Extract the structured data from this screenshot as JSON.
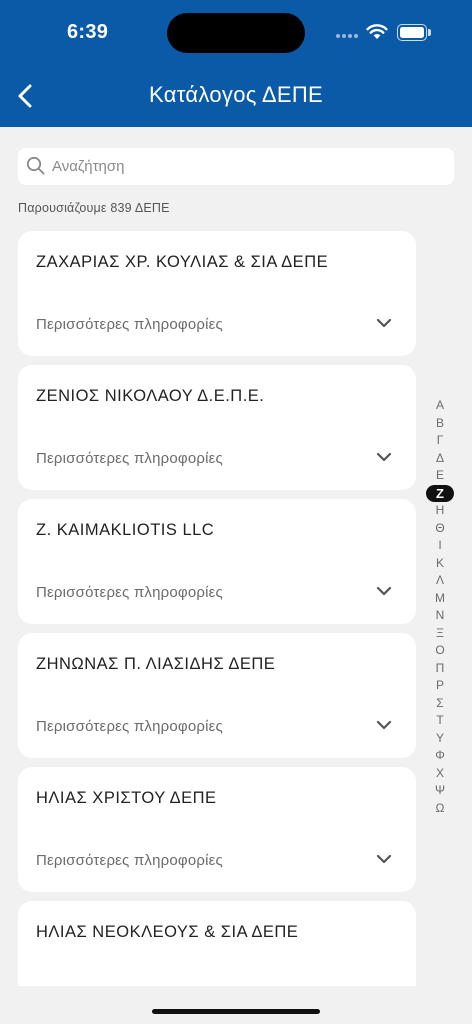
{
  "status_bar": {
    "time": "6:39"
  },
  "header": {
    "title": "Κατάλογος ΔΕΠΕ"
  },
  "search": {
    "placeholder": "Αναζήτηση",
    "value": ""
  },
  "result_count": "Παρουσιάζουμε 839 ΔΕΠΕ",
  "cards": [
    {
      "title": "ΖΑΧΑΡΙΑΣ ΧΡ. ΚΟΥΛΙΑΣ & ΣΙΑ ΔΕΠΕ",
      "more": "Περισσότερες πληροφορίες"
    },
    {
      "title": "ΖΕΝΙΟΣ ΝΙΚΟΛΑΟΥ Δ.Ε.Π.Ε.",
      "more": "Περισσότερες πληροφορίες"
    },
    {
      "title": "Z. KAIMAKLIOTIS LLC",
      "more": "Περισσότερες πληροφορίες"
    },
    {
      "title": "ΖΗΝΩΝΑΣ Π. ΛΙΑΣΙΔΗΣ ΔΕΠΕ",
      "more": "Περισσότερες πληροφορίες"
    },
    {
      "title": "ΗΛΙΑΣ ΧΡΙΣΤΟΥ ΔΕΠΕ",
      "more": "Περισσότερες πληροφορίες"
    },
    {
      "title": "ΗΛΙΑΣ ΝΕΟΚΛΕΟΥΣ & ΣΙΑ ΔΕΠΕ",
      "more": ""
    }
  ],
  "alphabet": [
    "Α",
    "Β",
    "Γ",
    "Δ",
    "Ε",
    "Z",
    "Η",
    "Θ",
    "Ι",
    "Κ",
    "Λ",
    "Μ",
    "Ν",
    "Ξ",
    "Ο",
    "Π",
    "Ρ",
    "Σ",
    "Τ",
    "Υ",
    "Φ",
    "Χ",
    "Ψ",
    "Ω"
  ],
  "alphabet_active": "Z",
  "colors": {
    "header": "#0a5aa8",
    "background": "#f1f1f1",
    "card": "#ffffff"
  }
}
